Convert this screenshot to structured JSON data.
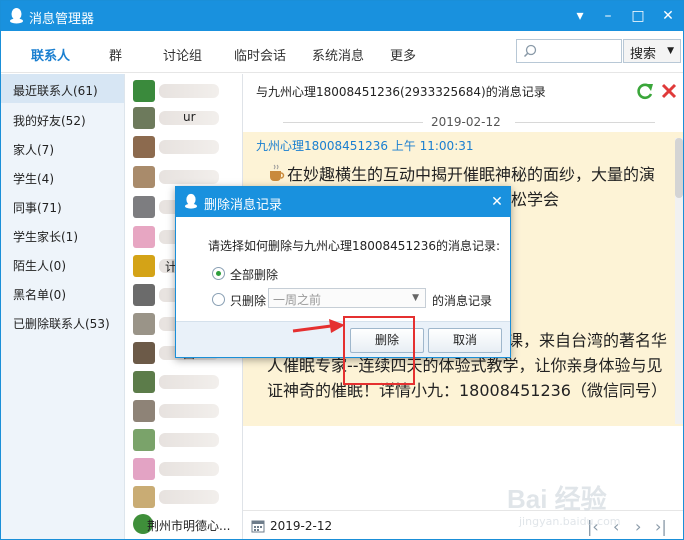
{
  "window": {
    "title": "消息管理器",
    "accent": "#1991de"
  },
  "nav": {
    "tabs": [
      "联系人",
      "群",
      "讨论组",
      "临时会话",
      "系统消息",
      "更多"
    ],
    "search_button": "搜索"
  },
  "categories": [
    "最近联系人(61)",
    "我的好友(52)",
    "家人(7)",
    "学生(4)",
    "同事(71)",
    "学生家长(1)",
    "陌生人(0)",
    "黑名单(0)",
    "已删除联系人(53)"
  ],
  "contacts": {
    "partial_labels": [
      "ur",
      "计",
      "西"
    ],
    "last_name": "荆州市明德心..."
  },
  "chat": {
    "header_title": "与九州心理18008451236(2933325684)的消息记录",
    "date_separator": "2019-02-12",
    "sender_line": "九州心理18008451236 上午 11:00:31",
    "message_top_line1": "在妙趣横生的互动中揭开催眠神秘的面纱，大量的演",
    "message_top_line2": "基础，也可轻松学会",
    "message_bottom": "授【国际催眠认证工作坊】长沙开课，来自台湾的著名华人催眠专家--连续四天的体验式教学，让你亲身体验与见证神奇的催眠！详情小九：18008451236（微信同号）",
    "footer_date": "2019-2-12"
  },
  "dialog": {
    "title": "删除消息记录",
    "prompt": "请选择如何删除与九州心理18008451236的消息记录:",
    "option_all": "全部删除",
    "option_partial": "只删除",
    "range_value": "一周之前",
    "range_suffix": "的消息记录",
    "ok_button": "删除",
    "cancel_button": "取消",
    "selected_option": "all"
  },
  "annotation": {
    "highlight_color": "#e53030"
  },
  "watermark": {
    "main": "Bai 经验",
    "sub": "jingyan.baidu.com"
  }
}
